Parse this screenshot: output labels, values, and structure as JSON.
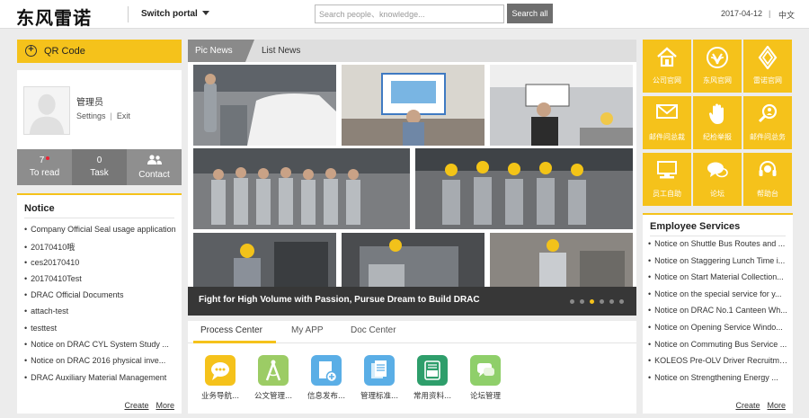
{
  "header": {
    "logo": "东风雷诺",
    "switch_portal": "Switch portal",
    "search_placeholder": "Search people、knowledge...",
    "search_button": "Search all",
    "date": "2017-04-12",
    "separator": "|",
    "language": "中文"
  },
  "left": {
    "qr_label": "QR Code",
    "user_name": "管理员",
    "settings": "Settings",
    "exit": "Exit",
    "link_separator": "|",
    "stats": [
      {
        "num": "7",
        "label": "To read"
      },
      {
        "num": "0",
        "label": "Task"
      },
      {
        "num": "",
        "label": "Contact"
      }
    ],
    "notice": {
      "title": "Notice",
      "items": [
        "Company Official Seal usage application",
        "20170410哦",
        "ces20170410",
        "20170410Test",
        "DRAC Official Documents",
        "attach-test",
        "testtest",
        "Notice on DRAC CYL System Study ...",
        "Notice on DRAC 2016 physical inve...",
        "DRAC Auxiliary Material Management"
      ],
      "create": "Create",
      "more": "More"
    }
  },
  "news": {
    "tabs": {
      "pic": "Pic News",
      "list": "List News"
    },
    "caption": "Fight for High Volume with Passion, Pursue Dream to Build DRAC",
    "slide_count": 6,
    "active_slide": 3
  },
  "apps": {
    "tabs": [
      "Process Center",
      "My APP",
      "Doc Center"
    ],
    "items": [
      {
        "label": "业务导航...",
        "color": "#f5c21b"
      },
      {
        "label": "公文管理...",
        "color": "#9ccc65"
      },
      {
        "label": "信息发布...",
        "color": "#5aaee6"
      },
      {
        "label": "管理标准...",
        "color": "#5aaee6"
      },
      {
        "label": "常用资料...",
        "color": "#2e9e6b"
      },
      {
        "label": "论坛管理",
        "color": "#8fcf6a"
      }
    ]
  },
  "tiles": [
    {
      "label": "公司官网",
      "icon": "house-icon"
    },
    {
      "label": "东风官网",
      "icon": "dongfeng-logo-icon"
    },
    {
      "label": "雷诺官网",
      "icon": "renault-logo-icon"
    },
    {
      "label": "邮件问总裁",
      "icon": "mail-icon"
    },
    {
      "label": "纪检举报",
      "icon": "hand-icon"
    },
    {
      "label": "邮件问总务",
      "icon": "magnifier-icon"
    },
    {
      "label": "员工自助",
      "icon": "computer-icon"
    },
    {
      "label": "论坛",
      "icon": "chat-icon"
    },
    {
      "label": "帮助台",
      "icon": "headset-icon"
    }
  ],
  "services": {
    "title": "Employee Services",
    "items": [
      "Notice on Shuttle Bus Routes and ...",
      "Notice on Staggering Lunch Time i...",
      "Notice on Start Material Collection...",
      "Notice on the special service for y...",
      "Notice on DRAC No.1 Canteen Wh...",
      "Notice on Opening Service Windo...",
      "Notice on Commuting Bus Service ...",
      "KOLEOS Pre-OLV Driver Recruitme...",
      "Notice on Strengthening Energy ..."
    ],
    "create": "Create",
    "more": "More"
  },
  "colors": {
    "accent": "#f5c21b",
    "dark_tab": "#8a8a8a"
  }
}
